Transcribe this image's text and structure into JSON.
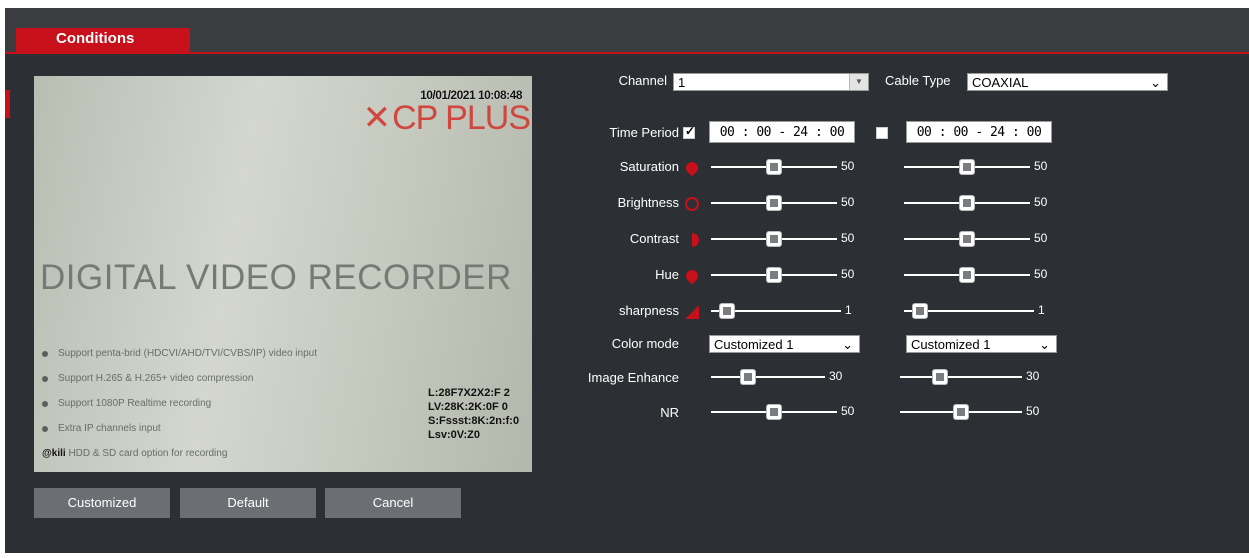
{
  "tab": {
    "label": "Conditions"
  },
  "preview": {
    "osd_time": "10/01/2021 10:08:48",
    "logo": "CP PLUS",
    "heading": "DIGITAL VIDEO RECORDER",
    "bullets": [
      "Support penta-brid (HDCVI/AHD/TVI/CVBS/IP) video input",
      "Support H.265 & H.265+ video compression",
      "Support 1080P Realtime recording",
      "Extra IP channels input",
      "HDD & SD card option for recording"
    ],
    "osd_logo": "@kili",
    "osd_stats": [
      "L:28F7X2X2:F 2",
      "LV:28K:2K:0F 0",
      "S:Fssst:8K:2n:f:0",
      "Lsv:0V:Z0"
    ]
  },
  "buttons": {
    "customized": "Customized",
    "default": "Default",
    "cancel": "Cancel"
  },
  "channel": {
    "label": "Channel",
    "value": "1"
  },
  "cable": {
    "label": "Cable Type",
    "value": "COAXIAL"
  },
  "time_period": {
    "label": "Time Period",
    "period1": {
      "checked": true,
      "value": "00 : 00 - 24 : 00"
    },
    "period2": {
      "checked": false,
      "value": "00 : 00 - 24 : 00"
    }
  },
  "sliders": [
    {
      "key": "saturation",
      "label": "Saturation",
      "v1": "50",
      "v2": "50",
      "max": 100
    },
    {
      "key": "brightness",
      "label": "Brightness",
      "v1": "50",
      "v2": "50",
      "max": 100
    },
    {
      "key": "contrast",
      "label": "Contrast",
      "v1": "50",
      "v2": "50",
      "max": 100
    },
    {
      "key": "hue",
      "label": "Hue",
      "v1": "50",
      "v2": "50",
      "max": 100
    },
    {
      "key": "sharpness",
      "label": "sharpness",
      "v1": "1",
      "v2": "1",
      "max": 15
    }
  ],
  "color_mode": {
    "label": "Color mode",
    "v1": "Customized 1",
    "v2": "Customized 1"
  },
  "image_enhance": {
    "label": "Image Enhance",
    "v1": "30",
    "v2": "30",
    "max": 100
  },
  "nr": {
    "label": "NR",
    "v1": "50",
    "v2": "50",
    "max": 100
  },
  "colors": {
    "accent": "#c8101a",
    "panel": "#2c2f33"
  }
}
